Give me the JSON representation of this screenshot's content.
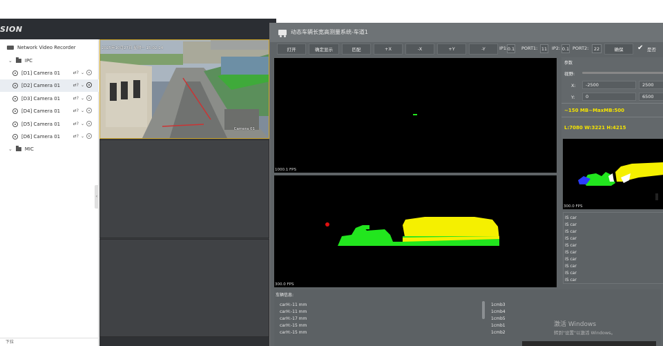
{
  "nvr": {
    "brand": "SION",
    "tree": [
      {
        "label": "Network Video Recorder",
        "type": "nvr"
      },
      {
        "label": "IPC",
        "type": "group"
      },
      {
        "label": "[D1] Camera 01",
        "type": "camera",
        "recording": false
      },
      {
        "label": "[D2] Camera 01",
        "type": "camera",
        "recording": true,
        "selected": true
      },
      {
        "label": "[D3] Camera 01",
        "type": "camera",
        "recording": false
      },
      {
        "label": "[D4] Camera 01",
        "type": "camera",
        "recording": false
      },
      {
        "label": "[D5] Camera 01",
        "type": "camera",
        "recording": false
      },
      {
        "label": "[D6] Camera 01",
        "type": "camera",
        "recording": false
      },
      {
        "label": "MIC",
        "type": "group"
      }
    ],
    "action_icon": "⇄?",
    "bottom_label": "下拉",
    "video": {
      "osd_time": "2025年10月27日 星期一 15:02:14",
      "camera_label": "Camera 01"
    }
  },
  "measure": {
    "title": "动态车辆长宽高测量系统-车道1",
    "toolbar": {
      "open": "打开",
      "display": "确定显示",
      "zoom": "匹配",
      "x_plus": "+X",
      "x_minus": "-X",
      "y_plus": "+Y",
      "y_minus": "-Y",
      "ip1_label": "IP1:",
      "ip1_value": "0.1",
      "port1_label": "PORT1:",
      "port1_value": "11",
      "ip2_label": "IP2:",
      "ip2_value": "0.1",
      "port2_label": "PORT2:",
      "port2_value": "22",
      "confirm": "确保",
      "truncated": "是否"
    },
    "top_view_fps": "1000.1 FPS",
    "side_view_fps": "300.0 FPS",
    "small_view_fps": "300.0 FPS",
    "params": {
      "title": "参数",
      "view_label": "视野:",
      "x_label": "X:",
      "x_min": "-2500",
      "x_max": "2500",
      "y_label": "Y:",
      "y_min": "0",
      "y_max": "6500",
      "memory": "~150 MB~MaxMB:500",
      "dims": "L:7080 W:3221 H:4215"
    },
    "is_car_list": [
      "IS car",
      "IS car",
      "IS car",
      "IS car",
      "IS car",
      "IS car",
      "IS car",
      "IS car",
      "IS car",
      "IS car"
    ],
    "car_info": {
      "title": "车辆信息:",
      "left_lines": [
        "carH:-11 mm",
        "carH:-11 mm",
        "carH:-17 mm",
        "carH:-15 mm",
        "carH:-15 mm"
      ],
      "right_lines": [
        "1cmb3",
        "1cmb4",
        "1cmb5",
        "1cmb1",
        "1cmb2"
      ]
    },
    "colors": {
      "truck_green": "#22e61e",
      "cargo_yellow": "#f5f000",
      "marker_red": "#e01010",
      "cloud_blue": "#2a3cff"
    }
  },
  "windows_watermark": {
    "line1": "激活 Windows",
    "line2": "转到\"设置\"以激活 Windows。"
  }
}
